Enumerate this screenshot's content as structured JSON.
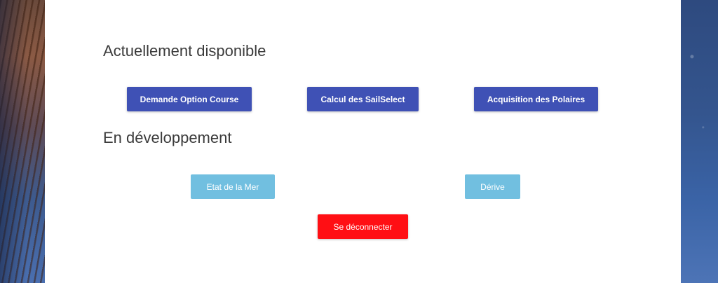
{
  "colors": {
    "primary": "#3f51b5",
    "dev": "#71bfe0",
    "danger": "#ff0f14",
    "panel": "#ffffff"
  },
  "sections": {
    "available": {
      "title": "Actuellement disponible",
      "buttons": [
        "Demande Option Course",
        "Calcul des SailSelect",
        "Acquisition des Polaires"
      ]
    },
    "development": {
      "title": "En développement",
      "buttons": [
        "Etat de la Mer",
        "Dérive"
      ]
    }
  },
  "logout_label": "Se déconnecter"
}
